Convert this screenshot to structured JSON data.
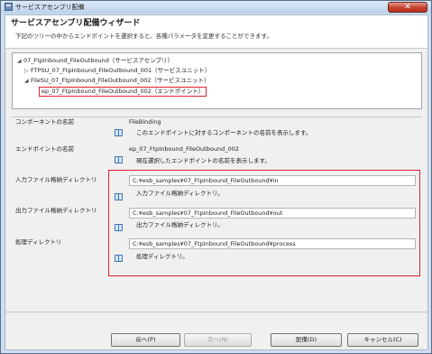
{
  "window": {
    "title": "サービスアセンブリ配備"
  },
  "header": {
    "title": "サービスアセンブリ配備ウィザード",
    "description": "下記のツリーの中からエンドポイントを選択すると、各種パラメータを変更することができます。"
  },
  "tree": {
    "nodes": [
      {
        "arrow": "◢",
        "label": "07_FtpInbound_FileOutbound（サービスアセンブリ）"
      },
      {
        "arrow": "▷",
        "label": "FTPSU_07_FtpInbound_FileOutbound_001（サービスユニット）"
      },
      {
        "arrow": "◢",
        "label": "FileSU_07_FtpInbound_FileOutbound_002（サービスユニット）"
      },
      {
        "arrow": "",
        "label": "ep_07_FtpInbound_FileOutbound_002（エンドポイント）"
      }
    ]
  },
  "fields": {
    "component": {
      "label": "コンポーネントの名前",
      "value": "FileBinding",
      "help": "このエンドポイントに対するコンポーネントの名前を表示します。"
    },
    "endpoint": {
      "label": "エンドポイントの名前",
      "value": "ep_07_FtpInbound_FileOutbound_002",
      "help": "現在選択したエンドポイントの名前を表示します。"
    },
    "input_dir": {
      "label": "入力ファイル格納ディレクトリ",
      "value": "C:¥esb_samples¥07_FtpInbound_FileOutbound¥in",
      "help": "入力ファイル格納ディレクトリ。"
    },
    "output_dir": {
      "label": "出力ファイル格納ディレクトリ",
      "value": "C:¥esb_samples¥07_FtpInbound_FileOutbound¥out",
      "help": "出力ファイル格納ディレクトリ。"
    },
    "process_dir": {
      "label": "処理ディレクトリ",
      "value": "C:¥esb_samples¥07_FtpInbound_FileOutbound¥process",
      "help": "処理ディレクトリ。"
    }
  },
  "buttons": {
    "back": "戻へ(P)",
    "next": "次へ(N)",
    "deploy": "配備(D)",
    "cancel": "キャンセル(C)"
  },
  "colors": {
    "highlight": "#e0202a",
    "close_button": "#c7412e"
  },
  "icons": {
    "window": "window-icon",
    "help": "help-book-icon"
  }
}
